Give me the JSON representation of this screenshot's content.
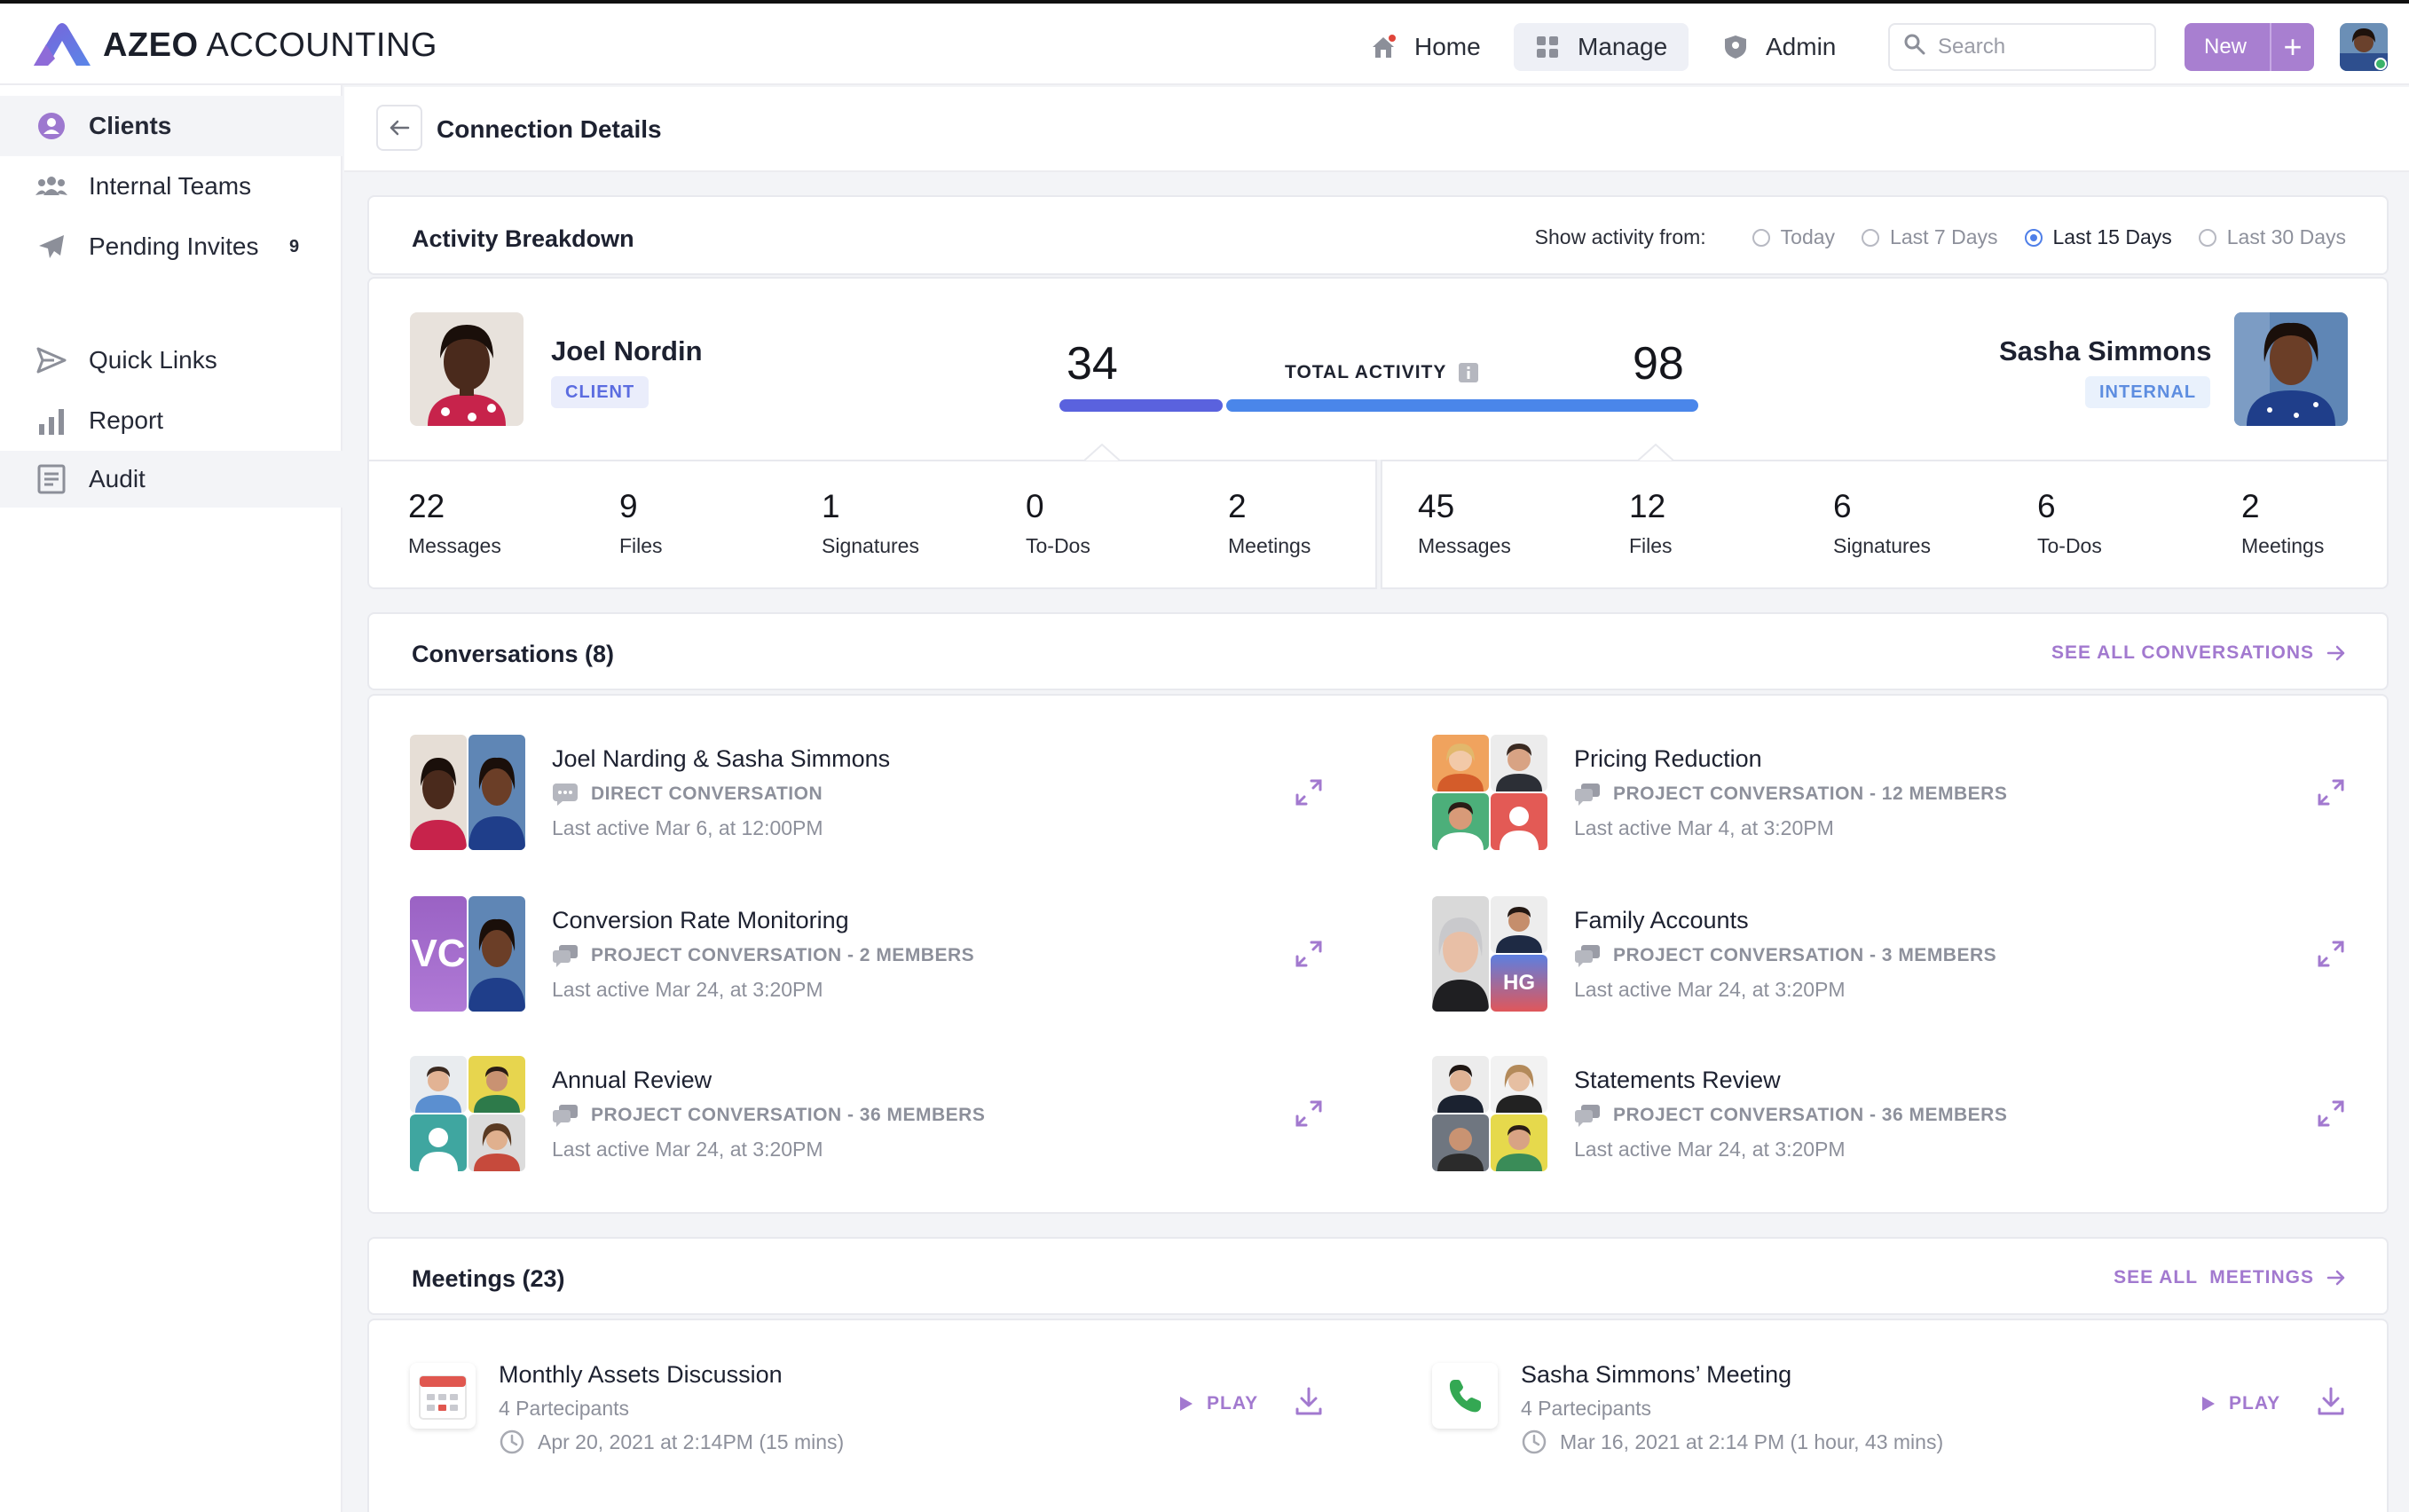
{
  "app": {
    "brand_bold": "AZEO",
    "brand_rest": " ACCOUNTING",
    "accent": "#a87fd0"
  },
  "topnav": {
    "home": "Home",
    "manage": "Manage",
    "admin": "Admin",
    "search_placeholder": "Search",
    "new_label": "New",
    "new_plus": "+"
  },
  "sidebar": {
    "items": [
      {
        "label": "Clients",
        "icon": "user-circle-icon"
      },
      {
        "label": "Internal Teams",
        "icon": "team-icon"
      },
      {
        "label": "Pending Invites",
        "icon": "paper-plane-icon",
        "count": "9"
      },
      {
        "label": "Quick Links",
        "icon": "send-icon"
      },
      {
        "label": "Report",
        "icon": "bar-chart-icon"
      },
      {
        "label": "Audit",
        "icon": "document-list-icon"
      }
    ]
  },
  "page": {
    "title": "Connection Details"
  },
  "activity": {
    "title": "Activity Breakdown",
    "filter_label": "Show activity from:",
    "filters": [
      {
        "label": "Today",
        "selected": false
      },
      {
        "label": "Last 7 Days",
        "selected": false
      },
      {
        "label": "Last 15 Days",
        "selected": true
      },
      {
        "label": "Last 30 Days",
        "selected": false
      }
    ],
    "left_person": {
      "name": "Joel Nordin",
      "role": "CLIENT",
      "total": "34"
    },
    "right_person": {
      "name": "Sasha Simmons",
      "role": "INTERNAL",
      "total": "98"
    },
    "total_label": "TOTAL ACTIVITY",
    "left_stats": [
      {
        "n": "22",
        "l": "Messages"
      },
      {
        "n": "9",
        "l": "Files"
      },
      {
        "n": "1",
        "l": "Signatures"
      },
      {
        "n": "0",
        "l": "To-Dos"
      },
      {
        "n": "2",
        "l": "Meetings"
      }
    ],
    "right_stats": [
      {
        "n": "45",
        "l": "Messages"
      },
      {
        "n": "12",
        "l": "Files"
      },
      {
        "n": "6",
        "l": "Signatures"
      },
      {
        "n": "6",
        "l": "To-Dos"
      },
      {
        "n": "2",
        "l": "Meetings"
      }
    ]
  },
  "conversations": {
    "title": "Conversations (8)",
    "see_all": "SEE ALL CONVERSATIONS",
    "items": [
      {
        "title": "Joel Narding & Sasha Simmons",
        "type": "DIRECT CONVERSATION",
        "last": "Last active Mar 6, at 12:00PM"
      },
      {
        "title": "Pricing Reduction",
        "type": "PROJECT CONVERSATION - 12 MEMBERS",
        "last": "Last active Mar 4, at 3:20PM"
      },
      {
        "title": "Conversion Rate Monitoring",
        "type": "PROJECT CONVERSATION - 2 MEMBERS",
        "last": "Last active Mar 24, at 3:20PM",
        "initials": "VC"
      },
      {
        "title": "Family Accounts",
        "type": "PROJECT CONVERSATION - 3 MEMBERS",
        "last": "Last active Mar 24, at 3:20PM",
        "initials": "HG"
      },
      {
        "title": "Annual Review",
        "type": "PROJECT CONVERSATION - 36 MEMBERS",
        "last": "Last active Mar 24, at 3:20PM"
      },
      {
        "title": "Statements Review",
        "type": "PROJECT CONVERSATION - 36 MEMBERS",
        "last": "Last active Mar 24, at 3:20PM"
      }
    ]
  },
  "meetings": {
    "title": "Meetings (23)",
    "see_all": "SEE ALL  MEETINGS",
    "items": [
      {
        "title": "Monthly Assets Discussion",
        "participants": "4 Partecipants",
        "when": "Apr 20, 2021 at 2:14PM (15 mins)",
        "play": "PLAY",
        "icon": "calendar-icon"
      },
      {
        "title": "Sasha Simmons’ Meeting",
        "participants": "4 Partecipants",
        "when": "Mar 16, 2021 at 2:14 PM (1 hour, 43 mins)",
        "play": "PLAY",
        "icon": "phone-icon"
      }
    ]
  }
}
